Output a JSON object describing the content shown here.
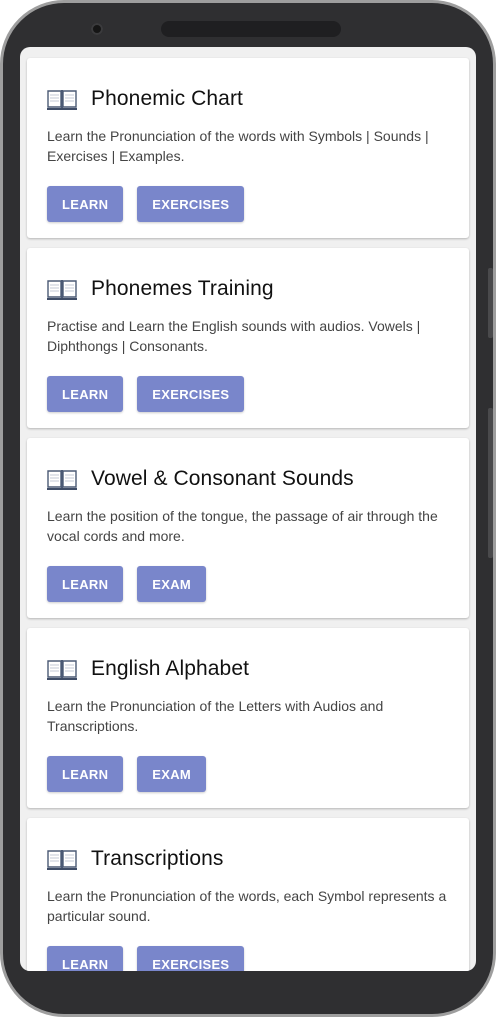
{
  "cards": [
    {
      "title": "Phonemic Chart",
      "description": "Learn the Pronunciation of the words with Symbols | Sounds | Exercises | Examples.",
      "icon": "book-icon",
      "buttons": [
        "LEARN",
        "EXERCISES"
      ]
    },
    {
      "title": "Phonemes Training",
      "description": "Practise and Learn the English sounds with audios. Vowels | Diphthongs | Consonants.",
      "icon": "book-icon",
      "buttons": [
        "LEARN",
        "EXERCISES"
      ]
    },
    {
      "title": "Vowel & Consonant Sounds",
      "description": "Learn the position of the tongue, the passage of air through the vocal cords and more.",
      "icon": "book-icon",
      "buttons": [
        "LEARN",
        "EXAM"
      ]
    },
    {
      "title": "English Alphabet",
      "description": "Learn the Pronunciation of the Letters with Audios and Transcriptions.",
      "icon": "book-icon",
      "buttons": [
        "LEARN",
        "EXAM"
      ]
    },
    {
      "title": "Transcriptions",
      "description": "Learn the Pronunciation of the words, each Symbol represents a particular sound.",
      "icon": "book-icon",
      "buttons": [
        "LEARN",
        "EXERCISES"
      ]
    }
  ],
  "colors": {
    "button": "#7986cb",
    "card": "#ffffff",
    "screen_background": "#f0f0f0",
    "device_frame": "#2f2f31"
  }
}
